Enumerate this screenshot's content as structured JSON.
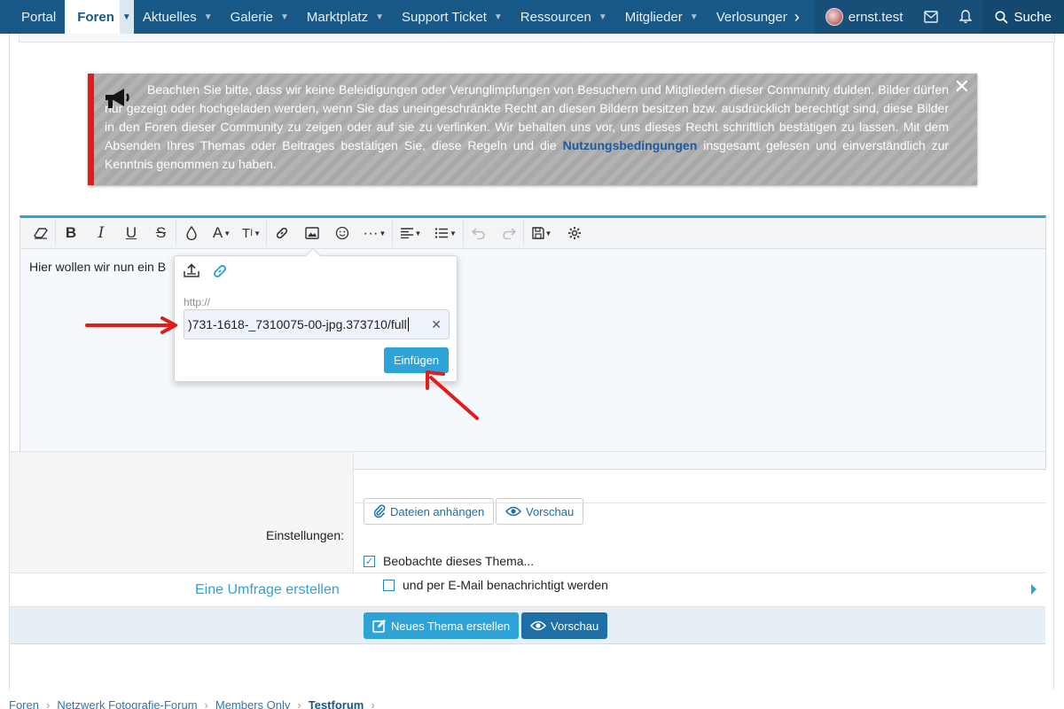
{
  "nav": {
    "tabs": [
      {
        "label": "Portal"
      },
      {
        "label": "Foren"
      },
      {
        "label": "Aktuelles"
      },
      {
        "label": "Galerie"
      },
      {
        "label": "Marktplatz"
      },
      {
        "label": "Support Ticket"
      },
      {
        "label": "Ressourcen"
      },
      {
        "label": "Mitglieder"
      },
      {
        "label": "Verlosungen"
      }
    ],
    "username": "ernst.test",
    "search_label": "Suche"
  },
  "notice": {
    "text_before": "Beachten Sie bitte, dass wir keine Beleidigungen oder Verunglimpfungen von Besuchern und Mitgliedern dieser Community dulden. Bilder dürfen nur gezeigt oder hochgeladen werden, wenn Sie das uneingeschränkte Recht an diesen Bildern besitzen bzw. ausdrücklich berechtigt sind, diese Bilder in den Foren dieser Community zu zeigen oder auf sie zu verlinken. Wir behalten uns vor, uns dieses Recht schriftlich bestätigen zu lassen. Mit dem Absenden Ihres Themas oder Beitrages bestätigen Sie, diese Regeln und die",
    "link": "Nutzungsbedingungen",
    "text_after": "insgesamt gelesen und einverständlich zur Kenntnis genommen zu haben."
  },
  "editor": {
    "body_text": "Hier wollen wir nun ein B"
  },
  "image_popup": {
    "url_label": "http://",
    "url_value": ")731-1618-_7310075-00-jpg.373710/full",
    "insert_label": "Einfügen"
  },
  "form": {
    "attach_label": "Dateien anhängen",
    "preview_label": "Vorschau",
    "settings_label": "Einstellungen:",
    "watch_label": "Beobachte dieses Thema...",
    "watch_checked": true,
    "email_label": "und per E-Mail benachrichtigt werden",
    "email_checked": false,
    "poll_label": "Eine Umfrage erstellen",
    "submit_label": "Neues Thema erstellen",
    "submit_preview_label": "Vorschau"
  },
  "breadcrumb": [
    "Foren",
    "Netzwerk Fotografie-Forum",
    "Members Only",
    "Testforum"
  ],
  "colors": {
    "nav_bg": "#185886",
    "accent": "#2ea3d8",
    "notice_border": "#e21b1b",
    "arrow": "#e21b1b"
  }
}
